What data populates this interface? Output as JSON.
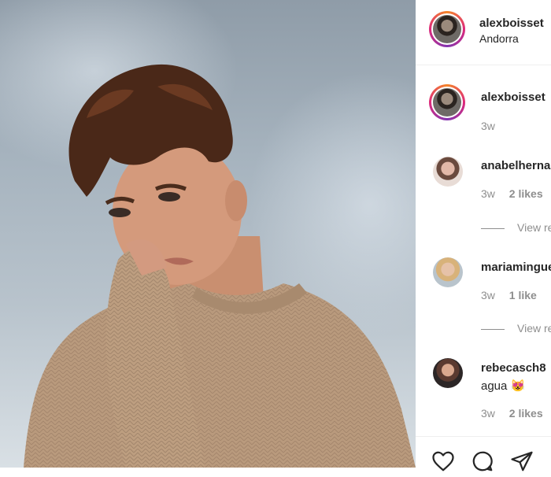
{
  "post": {
    "image_alt": "Curly-haired young man in a beige knit sweater resting his chin on his hands against a blurred snowy background"
  },
  "header": {
    "username": "alexboisset",
    "location": "Andorra"
  },
  "caption": {
    "username": "alexboisset",
    "time": "3w"
  },
  "comments": [
    {
      "username": "anabelhernandez",
      "time": "3w",
      "likes": "2 likes",
      "view_replies": "View replies"
    },
    {
      "username": "mariamingueza",
      "time": "3w",
      "likes": "1 like",
      "view_replies": "View replies"
    },
    {
      "username": "rebecasch8",
      "text": "agua 😻",
      "time": "3w",
      "likes": "2 likes"
    }
  ],
  "icons": {
    "like": "heart-icon",
    "comment": "comment-icon",
    "share": "paper-plane-icon"
  }
}
